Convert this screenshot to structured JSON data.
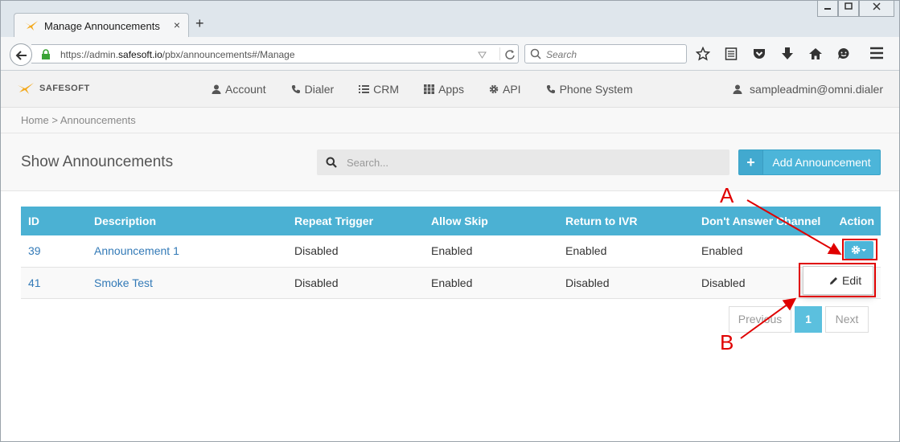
{
  "browser": {
    "tab_title": "Manage Announcements",
    "tab_close": "×",
    "new_tab": "+",
    "url_prefix": "https://admin.",
    "url_domain": "safesoft.io",
    "url_path": "/pbx/announcements#/Manage",
    "search_placeholder": "Search"
  },
  "app": {
    "brand": "SAFESOFT",
    "nav": [
      "Account",
      "Dialer",
      "CRM",
      "Apps",
      "API",
      "Phone System"
    ],
    "user": "sampleadmin@omni.dialer"
  },
  "breadcrumb": {
    "home": "Home",
    "separator": ">",
    "current": "Announcements"
  },
  "page": {
    "title": "Show Announcements",
    "search_placeholder": "Search...",
    "add_button": "Add Announcement"
  },
  "table": {
    "columns": [
      "ID",
      "Description",
      "Repeat Trigger",
      "Allow Skip",
      "Return to IVR",
      "Don't Answer Channel",
      "Action"
    ],
    "rows": [
      {
        "id": "39",
        "description": "Announcement 1",
        "repeat_trigger": "Disabled",
        "allow_skip": "Enabled",
        "return_ivr": "Enabled",
        "dont_answer": "Enabled"
      },
      {
        "id": "41",
        "description": "Smoke Test",
        "repeat_trigger": "Disabled",
        "allow_skip": "Enabled",
        "return_ivr": "Disabled",
        "dont_answer": "Disabled"
      }
    ]
  },
  "dropdown": {
    "edit_label": "Edit"
  },
  "pagination": {
    "previous": "Previous",
    "current": "1",
    "next": "Next"
  },
  "annotations": {
    "label_a": "A",
    "label_b": "B"
  },
  "colors": {
    "accent": "#4bb1d3",
    "annotation": "#e00000"
  }
}
